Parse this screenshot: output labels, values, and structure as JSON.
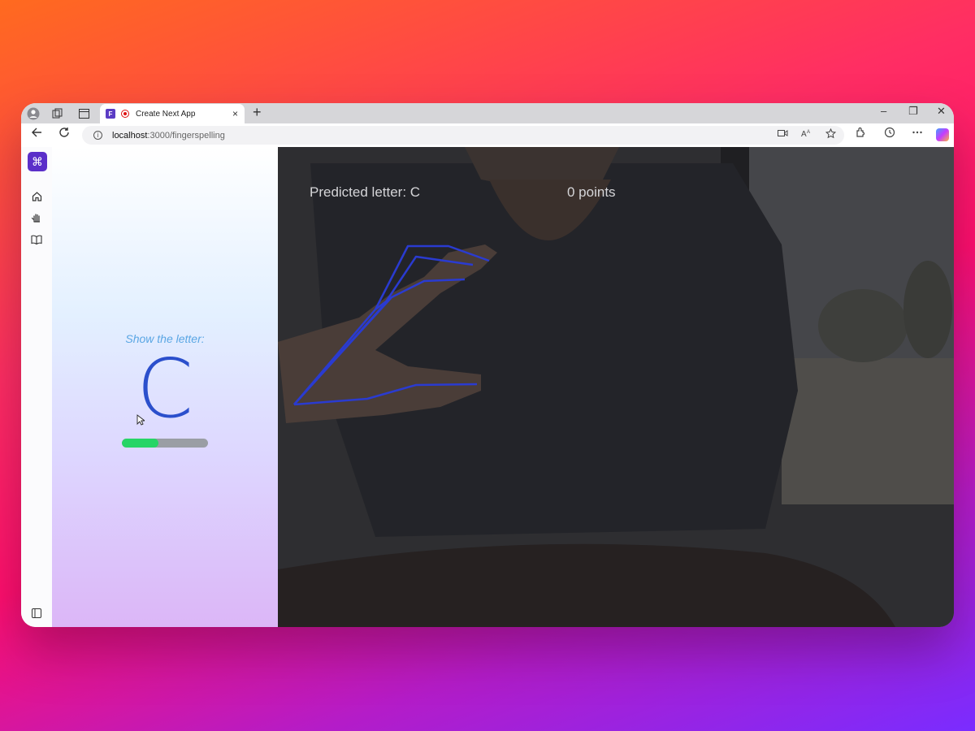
{
  "browser": {
    "tab": {
      "favicon_letter": "F",
      "title": "Create Next App",
      "close": "×"
    },
    "new_tab": "+",
    "url": {
      "host": "localhost",
      "path": ":3000/fingerspelling"
    },
    "window_controls": {
      "minimize": "–",
      "restore": "❐",
      "close": "✕"
    }
  },
  "app": {
    "logo_glyph": "⌘",
    "prompt": "Show the letter:",
    "target_letter": "C",
    "progress_fraction": 0.42,
    "predicted_text": "Predicted letter: C",
    "points_text": "0 points",
    "colors": {
      "accent": "#5b2fc9",
      "letter": "#2b4fcc",
      "progress": "#27d566",
      "landmarks": "#2a3bd0"
    }
  }
}
